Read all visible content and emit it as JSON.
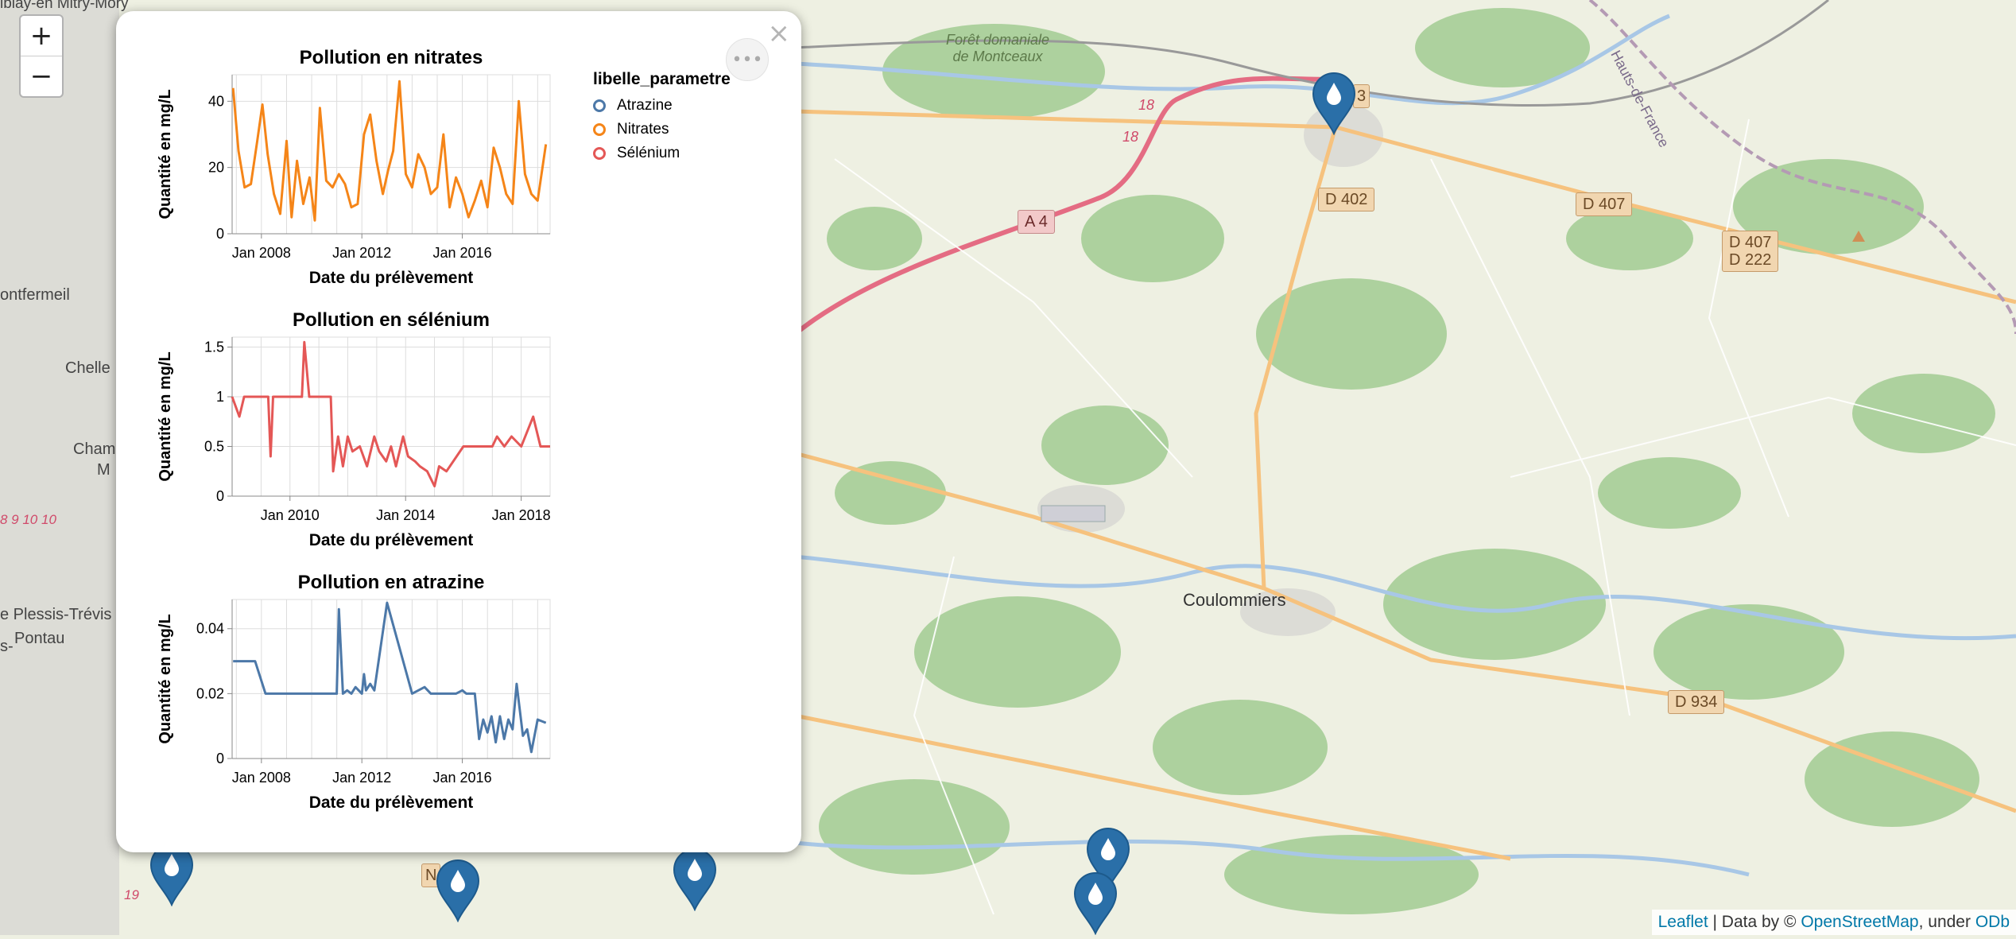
{
  "map": {
    "labels": {
      "foret": "Forêt domaniale de Montceaux",
      "hauts_de_france": "Hauts-de-France",
      "coulommiers": "Coulommiers",
      "montfermeil": "ontfermeil",
      "chelles": "Chelle",
      "champs": "Cham",
      "champs_line2": "M",
      "plessis": "e Plessis-Trévis",
      "pontault": "Pontau",
      "mitry": "ibiay-en    Mitry-Mory",
      "route_18a": "18",
      "route_18b": "18",
      "route_19": "19",
      "route_9_10": "8  9  10  10",
      "edge_s": "s-"
    },
    "roads": {
      "a4": "A 4",
      "d402": "D 402",
      "d407": "D 407",
      "d407_d222": [
        "D 407",
        "D 222"
      ],
      "d934": "D 934",
      "d3": "3",
      "n_fragment": "N"
    },
    "marker_icon": "water-drop-icon",
    "colors": {
      "marker": "#2a6fa8",
      "park": "#c8dfa5",
      "forest": "#add19e",
      "motorway": "#e46c83",
      "secondary_road": "#f6c27e"
    }
  },
  "zoom": {
    "in_label": "+",
    "out_label": "−"
  },
  "popup": {
    "close_label": "×",
    "actions_label": "•••",
    "legend": {
      "title": "libelle_parametre",
      "items": [
        {
          "label": "Atrazine",
          "color": "#4c78a8"
        },
        {
          "label": "Nitrates",
          "color": "#f58518"
        },
        {
          "label": "Sélénium",
          "color": "#e45756"
        }
      ]
    }
  },
  "attribution": {
    "leaflet": "Leaflet",
    "sep": " | Data by © ",
    "osm": "OpenStreetMap",
    "under": ", under ",
    "odb": "ODb"
  },
  "chart_data": [
    {
      "type": "line",
      "title": "Pollution en nitrates",
      "xlabel": "Date du prélèvement",
      "ylabel": "Quantité en mg/L",
      "color": "#f58518",
      "xlim": [
        "2006-11-01",
        "2019-07-01"
      ],
      "ylim": [
        0,
        48
      ],
      "yticks": [
        0,
        20,
        40
      ],
      "xticks": [
        {
          "date": "2008-01-01",
          "label": "Jan 2008"
        },
        {
          "date": "2012-01-01",
          "label": "Jan 2012"
        },
        {
          "date": "2016-01-01",
          "label": "Jan 2016"
        }
      ],
      "grid": true,
      "x": [
        "2006-11-15",
        "2007-02-01",
        "2007-05-01",
        "2007-08-01",
        "2007-11-01",
        "2008-01-15",
        "2008-04-01",
        "2008-07-01",
        "2008-10-01",
        "2009-01-01",
        "2009-03-15",
        "2009-06-01",
        "2009-09-01",
        "2009-12-01",
        "2010-02-15",
        "2010-05-01",
        "2010-08-01",
        "2010-11-01",
        "2011-02-01",
        "2011-05-01",
        "2011-08-01",
        "2011-11-01",
        "2012-02-01",
        "2012-05-01",
        "2012-08-01",
        "2012-11-01",
        "2013-01-15",
        "2013-04-01",
        "2013-07-01",
        "2013-10-01",
        "2014-01-01",
        "2014-04-01",
        "2014-07-01",
        "2014-10-01",
        "2015-01-01",
        "2015-04-01",
        "2015-07-01",
        "2015-10-01",
        "2016-01-01",
        "2016-04-01",
        "2016-07-01",
        "2016-10-01",
        "2017-01-01",
        "2017-04-01",
        "2017-07-01",
        "2017-10-01",
        "2018-01-01",
        "2018-04-01",
        "2018-07-01",
        "2018-10-01",
        "2019-01-01",
        "2019-05-01"
      ],
      "values": [
        44,
        25,
        14,
        15,
        28,
        39,
        24,
        12,
        6,
        28,
        5,
        22,
        9,
        17,
        4,
        38,
        16,
        14,
        18,
        15,
        8,
        9,
        30,
        36,
        22,
        12,
        19,
        25,
        46,
        18,
        14,
        24,
        20,
        12,
        14,
        30,
        8,
        17,
        12,
        5,
        10,
        16,
        8,
        26,
        20,
        12,
        9,
        40,
        18,
        12,
        10,
        27
      ]
    },
    {
      "type": "line",
      "title": "Pollution en sélénium",
      "xlabel": "Date du prélèvement",
      "ylabel": "Quantité en mg/L",
      "color": "#e45756",
      "xlim": [
        "2008-01-01",
        "2019-01-01"
      ],
      "ylim": [
        0,
        1.6
      ],
      "yticks": [
        0.0,
        0.5,
        1.0,
        1.5
      ],
      "xticks": [
        {
          "date": "2010-01-01",
          "label": "Jan 2010"
        },
        {
          "date": "2014-01-01",
          "label": "Jan 2014"
        },
        {
          "date": "2018-01-01",
          "label": "Jan 2018"
        }
      ],
      "grid": true,
      "x": [
        "2008-01-01",
        "2008-04-01",
        "2008-06-01",
        "2008-12-01",
        "2009-04-01",
        "2009-05-01",
        "2009-06-01",
        "2009-08-01",
        "2010-06-01",
        "2010-07-01",
        "2010-09-01",
        "2011-06-01",
        "2011-07-01",
        "2011-09-01",
        "2011-11-01",
        "2012-01-01",
        "2012-03-01",
        "2012-06-01",
        "2012-09-01",
        "2012-12-01",
        "2013-02-01",
        "2013-05-01",
        "2013-07-01",
        "2013-09-01",
        "2013-12-01",
        "2014-02-01",
        "2014-05-01",
        "2014-07-01",
        "2014-10-01",
        "2015-01-01",
        "2015-03-01",
        "2015-06-01",
        "2016-01-01",
        "2016-06-01",
        "2017-01-01",
        "2017-03-01",
        "2017-06-01",
        "2017-09-01",
        "2018-01-01",
        "2018-06-01",
        "2018-09-01",
        "2019-01-01"
      ],
      "values": [
        1.0,
        0.8,
        1.0,
        1.0,
        1.0,
        0.4,
        1.0,
        1.0,
        1.0,
        1.55,
        1.0,
        1.0,
        0.25,
        0.6,
        0.3,
        0.6,
        0.45,
        0.5,
        0.3,
        0.6,
        0.45,
        0.35,
        0.5,
        0.3,
        0.6,
        0.4,
        0.35,
        0.3,
        0.25,
        0.1,
        0.3,
        0.25,
        0.5,
        0.5,
        0.5,
        0.6,
        0.5,
        0.6,
        0.5,
        0.8,
        0.5,
        0.5
      ]
    },
    {
      "type": "line",
      "title": "Pollution en atrazine",
      "xlabel": "Date du prélèvement",
      "ylabel": "Quantité en mg/L",
      "color": "#4c78a8",
      "xlim": [
        "2006-11-01",
        "2019-07-01"
      ],
      "ylim": [
        0,
        0.049
      ],
      "yticks": [
        0.0,
        0.02,
        0.04
      ],
      "xticks": [
        {
          "date": "2008-01-01",
          "label": "Jan 2008"
        },
        {
          "date": "2012-01-01",
          "label": "Jan 2012"
        },
        {
          "date": "2016-01-01",
          "label": "Jan 2016"
        }
      ],
      "grid": true,
      "x": [
        "2006-11-15",
        "2007-06-01",
        "2007-10-01",
        "2008-03-01",
        "2009-01-01",
        "2010-01-01",
        "2010-11-01",
        "2011-01-01",
        "2011-02-01",
        "2011-04-01",
        "2011-06-01",
        "2011-08-01",
        "2011-10-01",
        "2012-01-01",
        "2012-02-01",
        "2012-03-01",
        "2012-05-01",
        "2012-07-01",
        "2013-01-01",
        "2014-01-01",
        "2014-07-01",
        "2014-10-01",
        "2015-06-01",
        "2015-10-01",
        "2016-01-01",
        "2016-03-01",
        "2016-05-01",
        "2016-07-01",
        "2016-09-01",
        "2016-11-01",
        "2017-01-01",
        "2017-03-01",
        "2017-05-01",
        "2017-07-01",
        "2017-09-01",
        "2017-11-01",
        "2018-01-01",
        "2018-03-01",
        "2018-06-01",
        "2018-08-01",
        "2018-10-01",
        "2019-01-01",
        "2019-05-01"
      ],
      "values": [
        0.03,
        0.03,
        0.03,
        0.02,
        0.02,
        0.02,
        0.02,
        0.02,
        0.046,
        0.02,
        0.021,
        0.02,
        0.022,
        0.02,
        0.026,
        0.021,
        0.023,
        0.021,
        0.048,
        0.02,
        0.022,
        0.02,
        0.02,
        0.02,
        0.021,
        0.02,
        0.02,
        0.02,
        0.006,
        0.012,
        0.008,
        0.013,
        0.005,
        0.013,
        0.006,
        0.012,
        0.009,
        0.023,
        0.007,
        0.009,
        0.002,
        0.012,
        0.011
      ]
    }
  ]
}
